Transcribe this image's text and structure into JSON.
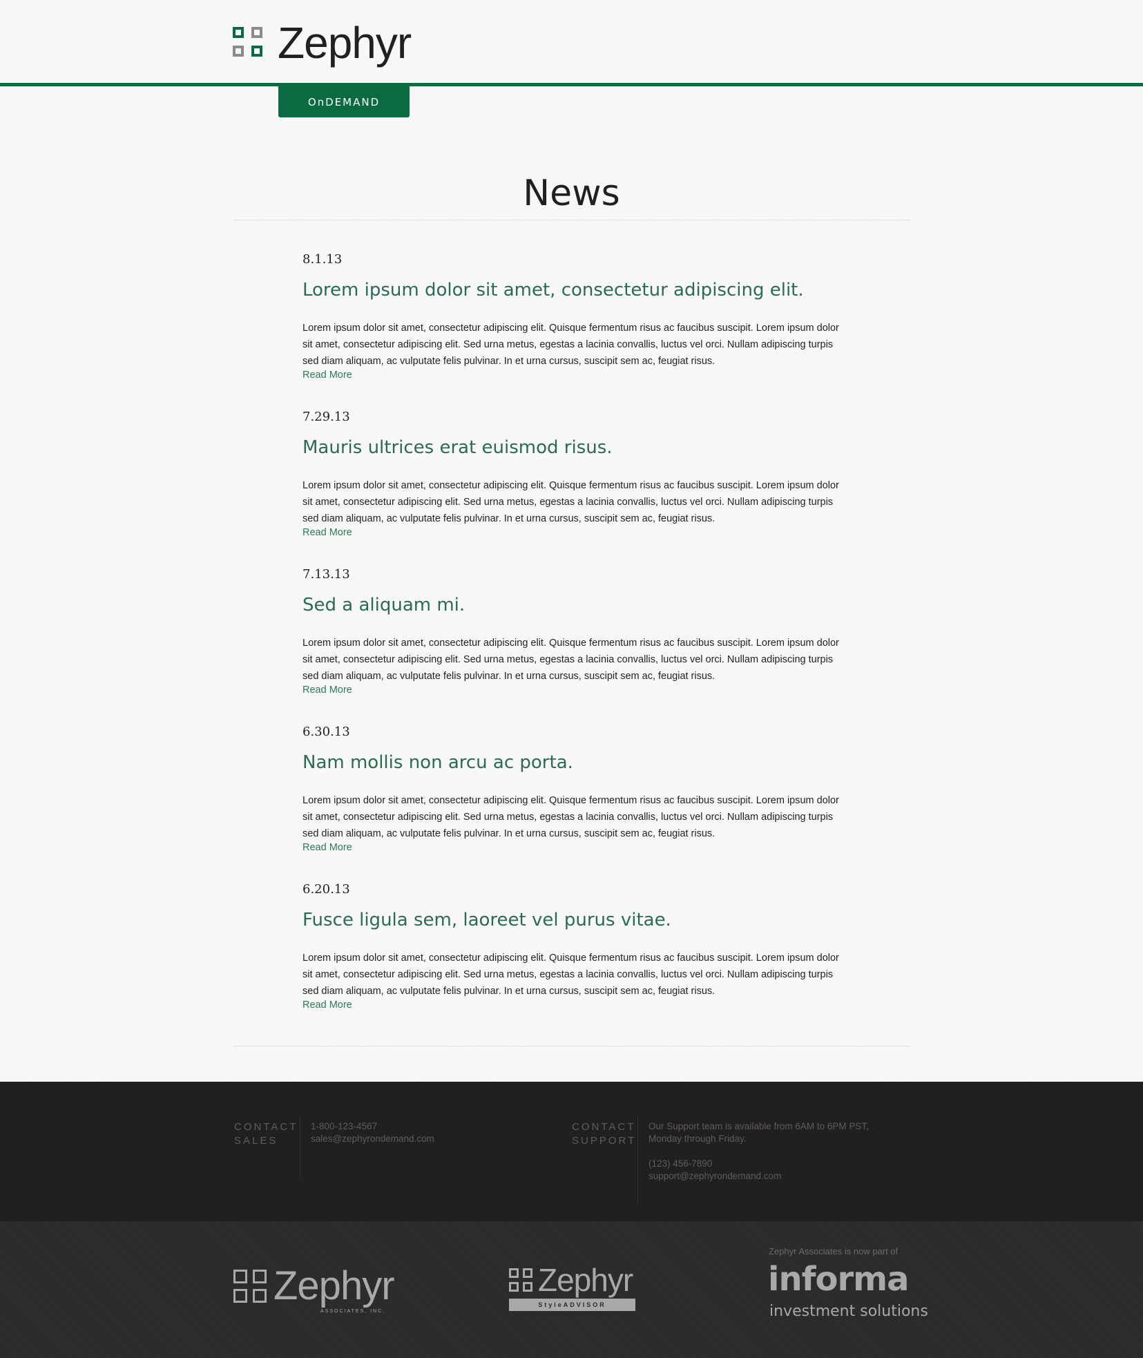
{
  "header": {
    "brand": "Zephyr",
    "tab_label": "OnDEMAND"
  },
  "page": {
    "title": "News"
  },
  "news": [
    {
      "date": "8.1.13",
      "title": "Lorem ipsum dolor sit amet, consectetur adipiscing elit.",
      "body": "Lorem ipsum dolor sit amet, consectetur adipiscing elit. Quisque fermentum risus ac faucibus suscipit. Lorem ipsum dolor sit amet, consectetur adipiscing elit. Sed urna metus, egestas a lacinia convallis, luctus vel orci. Nullam adipiscing turpis sed diam aliquam, ac vulputate felis pulvinar. In et urna cursus, suscipit sem ac, feugiat risus.",
      "link": "Read More"
    },
    {
      "date": "7.29.13",
      "title": "Mauris ultrices erat euismod risus.",
      "body": "Lorem ipsum dolor sit amet, consectetur adipiscing elit. Quisque fermentum risus ac faucibus suscipit. Lorem ipsum dolor sit amet, consectetur adipiscing elit. Sed urna metus, egestas a lacinia convallis, luctus vel orci. Nullam adipiscing turpis sed diam aliquam, ac vulputate felis pulvinar. In et urna cursus, suscipit sem ac, feugiat risus.",
      "link": "Read More"
    },
    {
      "date": "7.13.13",
      "title": "Sed a aliquam mi.",
      "body": "Lorem ipsum dolor sit amet, consectetur adipiscing elit. Quisque fermentum risus ac faucibus suscipit. Lorem ipsum dolor sit amet, consectetur adipiscing elit. Sed urna metus, egestas a lacinia convallis, luctus vel orci. Nullam adipiscing turpis sed diam aliquam, ac vulputate felis pulvinar. In et urna cursus, suscipit sem ac, feugiat risus.",
      "link": "Read More"
    },
    {
      "date": "6.30.13",
      "title": "Nam mollis non arcu ac porta.",
      "body": "Lorem ipsum dolor sit amet, consectetur adipiscing elit. Quisque fermentum risus ac faucibus suscipit. Lorem ipsum dolor sit amet, consectetur adipiscing elit. Sed urna metus, egestas a lacinia convallis, luctus vel orci. Nullam adipiscing turpis sed diam aliquam, ac vulputate felis pulvinar. In et urna cursus, suscipit sem ac, feugiat risus.",
      "link": "Read More"
    },
    {
      "date": "6.20.13",
      "title": "Fusce ligula sem, laoreet vel purus vitae.",
      "body": "Lorem ipsum dolor sit amet, consectetur adipiscing elit. Quisque fermentum risus ac faucibus suscipit. Lorem ipsum dolor sit amet, consectetur adipiscing elit. Sed urna metus, egestas a lacinia convallis, luctus vel orci. Nullam adipiscing turpis sed diam aliquam, ac vulputate felis pulvinar. In et urna cursus, suscipit sem ac, feugiat risus.",
      "link": "Read More"
    }
  ],
  "contact": {
    "sales": {
      "label_line1": "CONTACT",
      "label_line2": "SALES",
      "phone": "1-800-123-4567",
      "email": "sales@zephyrondemand.com"
    },
    "support": {
      "label_line1": "CONTACT",
      "label_line2": "SUPPORT",
      "hours_line1": "Our Support team is available from 6AM to 6PM PST,",
      "hours_line2": "Monday through Friday.",
      "phone": "(123) 456-7890",
      "email": "support@zephyrondemand.com"
    }
  },
  "footer_logos": {
    "associates": {
      "name": "Zephyr",
      "sub": "ASSOCIATES, INC."
    },
    "styleadvisor": {
      "name": "Zephyr",
      "sub": "StyleADVISOR"
    },
    "informa": {
      "note": "Zephyr Associates is now part of",
      "name": "informa",
      "sub": "investment solutions"
    }
  },
  "colors": {
    "brand_green": "#0a6b42",
    "link_green": "#2a6c4f",
    "footer_dark": "#221f20"
  }
}
